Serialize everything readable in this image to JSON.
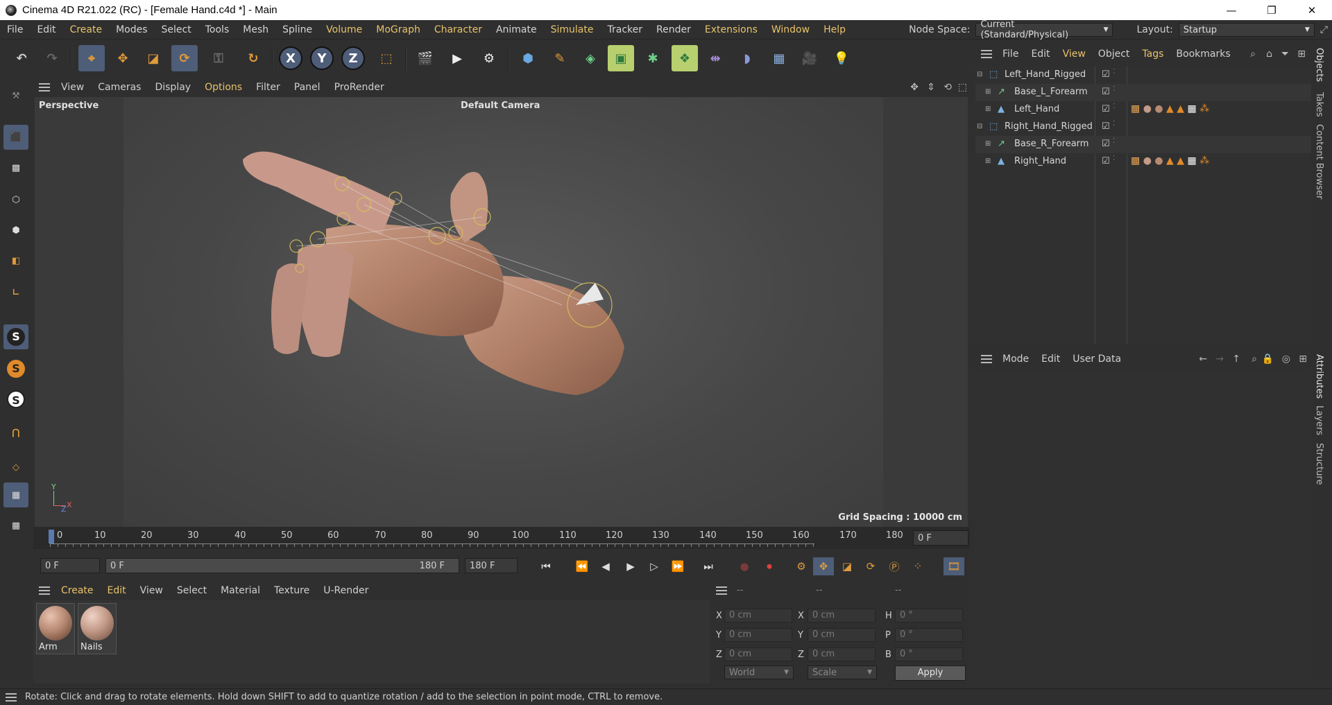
{
  "window": {
    "title": "Cinema 4D R21.022 (RC) - [Female Hand.c4d *] - Main",
    "minimize": "—",
    "maximize": "❐",
    "close": "✕"
  },
  "menubar": {
    "items": [
      "File",
      "Edit",
      "Create",
      "Modes",
      "Select",
      "Tools",
      "Mesh",
      "Spline",
      "Volume",
      "MoGraph",
      "Character",
      "Animate",
      "Simulate",
      "Tracker",
      "Render",
      "Extensions",
      "Window",
      "Help"
    ],
    "node_space_label": "Node Space:",
    "node_space_value": "Current (Standard/Physical)",
    "layout_label": "Layout:",
    "layout_value": "Startup"
  },
  "toolbar": {
    "axis_x": "X",
    "axis_y": "Y",
    "axis_z": "Z"
  },
  "left_toolbar": {
    "s1": "S",
    "s2": "S",
    "s3": "S"
  },
  "viewport": {
    "menu": [
      "View",
      "Cameras",
      "Display",
      "Options",
      "Filter",
      "Panel",
      "ProRender"
    ],
    "label": "Perspective",
    "camera": "Default Camera",
    "grid_spacing": "Grid Spacing : 10000 cm",
    "axis_x": "X",
    "axis_y": "Y",
    "axis_z": "Z"
  },
  "timeline": {
    "ticks": [
      "0",
      "10",
      "20",
      "30",
      "40",
      "50",
      "60",
      "70",
      "80",
      "90",
      "100",
      "110",
      "120",
      "130",
      "140",
      "150",
      "160",
      "170",
      "180"
    ],
    "current_frame_right": "0 F",
    "start_field": "0 F",
    "range_start": "0 F",
    "range_end": "180 F",
    "end_field": "180 F"
  },
  "materials": {
    "menu": [
      "Create",
      "Edit",
      "View",
      "Select",
      "Material",
      "Texture",
      "U-Render"
    ],
    "items": [
      {
        "name": "Arm",
        "color": "#b88a73"
      },
      {
        "name": "Nails",
        "color": "#c49a88"
      }
    ]
  },
  "coordinates": {
    "header": [
      "--",
      "--",
      "--"
    ],
    "rows": [
      {
        "l1": "X",
        "v1": "0 cm",
        "l2": "X",
        "v2": "0 cm",
        "l3": "H",
        "v3": "0 °"
      },
      {
        "l1": "Y",
        "v1": "0 cm",
        "l2": "Y",
        "v2": "0 cm",
        "l3": "P",
        "v3": "0 °"
      },
      {
        "l1": "Z",
        "v1": "0 cm",
        "l2": "Z",
        "v2": "0 cm",
        "l3": "B",
        "v3": "0 °"
      }
    ],
    "mode_select": "World",
    "size_select": "Scale",
    "apply": "Apply"
  },
  "objects": {
    "menu": [
      "File",
      "Edit",
      "View",
      "Object",
      "Tags",
      "Bookmarks"
    ],
    "rows": [
      {
        "name": "Left_Hand_Rigged",
        "indent": 0
      },
      {
        "name": "Base_L_Forearm",
        "indent": 1
      },
      {
        "name": "Left_Hand",
        "indent": 1
      },
      {
        "name": "Right_Hand_Rigged",
        "indent": 0
      },
      {
        "name": "Base_R_Forearm",
        "indent": 1
      },
      {
        "name": "Right_Hand",
        "indent": 1
      }
    ]
  },
  "attributes": {
    "menu": [
      "Mode",
      "Edit",
      "User Data"
    ]
  },
  "side_tabs": [
    "Objects",
    "Takes",
    "Content Browser",
    "Attributes",
    "Layers",
    "Structure"
  ],
  "status": "Rotate: Click and drag to rotate elements. Hold down SHIFT to add to quantize rotation / add to the selection in point mode, CTRL to remove."
}
